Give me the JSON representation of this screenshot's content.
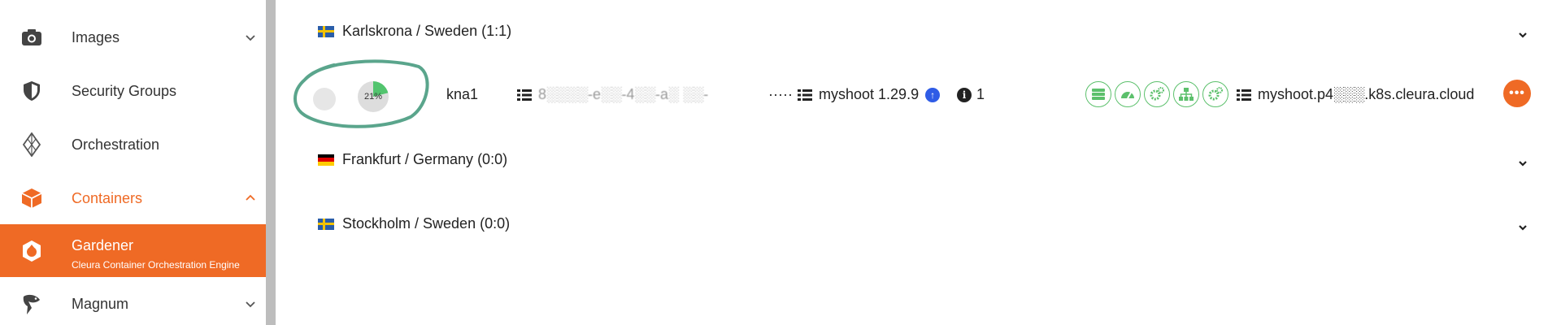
{
  "sidebar": {
    "items": [
      {
        "label": "Images",
        "icon": "camera-icon"
      },
      {
        "label": "Security Groups",
        "icon": "shield-icon"
      },
      {
        "label": "Orchestration",
        "icon": "orchestration-icon"
      },
      {
        "label": "Containers",
        "icon": "cube-icon"
      },
      {
        "label": "Gardener",
        "sublabel": "Cleura Container Orchestration Engine",
        "icon": "gardener-icon"
      },
      {
        "label": "Magnum",
        "icon": "shark-icon"
      }
    ]
  },
  "regions": [
    {
      "name": "Karlskrona / Sweden",
      "count": "(1:1)",
      "flag": "sweden"
    },
    {
      "name": "Frankfurt / Germany",
      "count": "(0:0)",
      "flag": "germany"
    },
    {
      "name": "Stockholm / Sweden",
      "count": "(0:0)",
      "flag": "sweden"
    }
  ],
  "cluster": {
    "progress_label": "21%",
    "progress_value": 21,
    "region_code": "kna1",
    "id_text": "8░░░░-e░░-4░░-a░ ░░-",
    "dots": "·····",
    "name": "myshoot",
    "version": "1.29.9",
    "info_count": "1",
    "domain": "myshoot.p4░░░.k8s.cleura.cloud",
    "more": "•••"
  },
  "colors": {
    "accent": "#ef6a25",
    "green": "#5cc06c",
    "blue": "#2f5ce6",
    "annotation": "#5aa58c"
  }
}
